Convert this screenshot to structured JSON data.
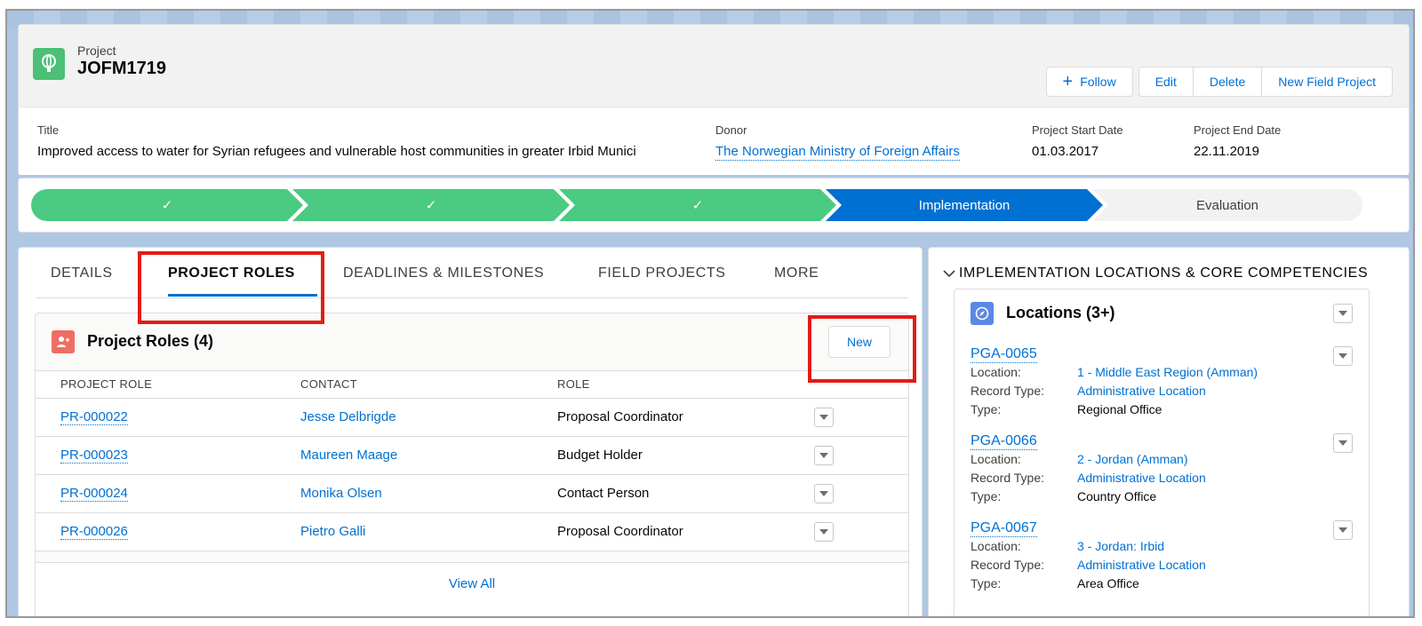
{
  "header": {
    "object_label": "Project",
    "record_name": "JOFM1719",
    "actions": {
      "follow": "Follow",
      "edit": "Edit",
      "delete": "Delete",
      "new_field_project": "New Field Project"
    },
    "fields": {
      "title_label": "Title",
      "title_value": "Improved access to water for Syrian refugees and vulnerable host communities in greater Irbid Munici",
      "donor_label": "Donor",
      "donor_value": "The Norwegian Ministry of Foreign Affairs",
      "start_label": "Project Start Date",
      "start_value": "01.03.2017",
      "end_label": "Project End Date",
      "end_value": "22.11.2019"
    }
  },
  "path": {
    "steps": [
      {
        "label": "✓",
        "state": "complete"
      },
      {
        "label": "✓",
        "state": "complete"
      },
      {
        "label": "✓",
        "state": "complete"
      },
      {
        "label": "Implementation",
        "state": "current"
      },
      {
        "label": "Evaluation",
        "state": "incomplete"
      }
    ]
  },
  "tabs": [
    {
      "label": "DETAILS",
      "active": false
    },
    {
      "label": "PROJECT ROLES",
      "active": true
    },
    {
      "label": "DEADLINES & MILESTONES",
      "active": false
    },
    {
      "label": "FIELD PROJECTS",
      "active": false
    },
    {
      "label": "MORE",
      "active": false
    }
  ],
  "project_roles": {
    "title": "Project Roles (4)",
    "new_label": "New",
    "columns": [
      "PROJECT ROLE",
      "CONTACT",
      "ROLE"
    ],
    "rows": [
      {
        "id": "PR-000022",
        "contact": "Jesse Delbrigde",
        "role": "Proposal Coordinator"
      },
      {
        "id": "PR-000023",
        "contact": "Maureen Maage",
        "role": "Budget Holder"
      },
      {
        "id": "PR-000024",
        "contact": "Monika Olsen",
        "role": "Contact Person"
      },
      {
        "id": "PR-000026",
        "contact": "Pietro Galli",
        "role": "Proposal Coordinator"
      }
    ],
    "view_all": "View All"
  },
  "side": {
    "section_title": "IMPLEMENTATION LOCATIONS & CORE COMPETENCIES",
    "locations_title": "Locations (3+)",
    "location_label": "Location:",
    "record_type_label": "Record Type:",
    "type_label": "Type:",
    "items": [
      {
        "id": "PGA-0065",
        "location": "1 - Middle East Region (Amman)",
        "record_type": "Administrative Location",
        "type": "Regional Office"
      },
      {
        "id": "PGA-0066",
        "location": "2 - Jordan (Amman)",
        "record_type": "Administrative Location",
        "type": "Country Office"
      },
      {
        "id": "PGA-0067",
        "location": "3 - Jordan: Irbid",
        "record_type": "Administrative Location",
        "type": "Area Office"
      }
    ]
  },
  "colors": {
    "accent": "#0070d2",
    "path_complete": "#4bca81",
    "highlight_box": "#e41b17",
    "project_icon": "#4bc076",
    "roles_icon": "#ef6e64",
    "locations_icon": "#5b88e4"
  }
}
